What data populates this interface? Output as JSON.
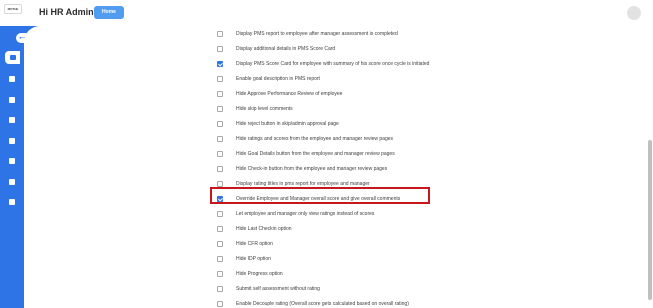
{
  "header": {
    "logo_text": "MOTHE",
    "title": "Hi HR Admin",
    "home_label": "Home"
  },
  "sidebar": {
    "toggle_label": "⇤⇥",
    "icons": [
      "dashboard-icon",
      "users-icon",
      "visibility-icon",
      "calendar-icon",
      "document-icon",
      "analytics-icon",
      "checklist-icon",
      "settings-icon"
    ]
  },
  "colors": {
    "primary": "#2f74e6",
    "highlight": "#c8161d"
  },
  "options": [
    {
      "label": "Display PMS report to employee after manager assessment is completed",
      "checked": false
    },
    {
      "label": "Display additional details in PMS Score Card",
      "checked": false
    },
    {
      "label": "Display PMS Score Card for employee with summary of his score once cycle is initiated",
      "checked": true
    },
    {
      "label": "Enable goal description in PMS report",
      "checked": false
    },
    {
      "label": "Hide Approve Performance Review of employee",
      "checked": false
    },
    {
      "label": "Hide skip level comments",
      "checked": false
    },
    {
      "label": "Hide reject button in skip/admin approval page",
      "checked": false
    },
    {
      "label": "Hide ratings and scores from the employee and manager review pages",
      "checked": false
    },
    {
      "label": "Hide Goal Details button from the employee and manager review pages",
      "checked": false
    },
    {
      "label": "Hide Check-in button from the employee and manager review pages",
      "checked": false
    },
    {
      "label": "Display rating titles in pms report for employee and manager",
      "checked": false
    },
    {
      "label": "Override Employee and Manager overall score and give overall comments",
      "checked": true
    },
    {
      "label": "Let employee and manager only view ratings instead of scores",
      "checked": false
    },
    {
      "label": "Hide Last Checkin option",
      "checked": false
    },
    {
      "label": "Hide CFR option",
      "checked": false
    },
    {
      "label": "Hide IDP option",
      "checked": false
    },
    {
      "label": "Hide Progress option",
      "checked": false
    },
    {
      "label": "Submit self assessment without rating",
      "checked": false
    },
    {
      "label": "Enable Decouple rating (Overall score gets calculated based on overall rating)",
      "checked": false
    }
  ]
}
